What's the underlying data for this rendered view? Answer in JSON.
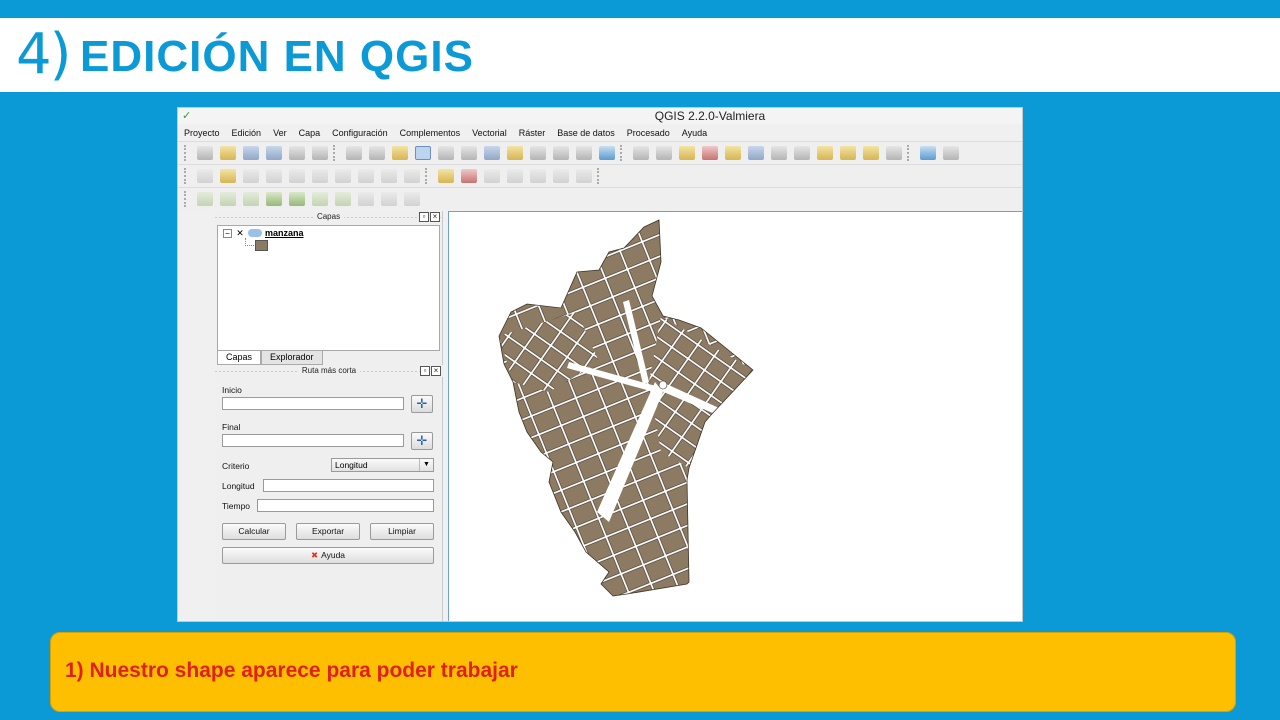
{
  "slide": {
    "title_number": "4)",
    "title_text": "EDICIÓN EN QGIS",
    "caption": "1) Nuestro shape aparece para poder trabajar",
    "colors": {
      "background": "#0b9ad6",
      "caption_bg": "#fdbf00",
      "caption_text": "#e0201a",
      "title": "#0b9ad6"
    }
  },
  "qgis": {
    "window_title": "QGIS 2.2.0-Valmiera",
    "menu": [
      "Proyecto",
      "Edición",
      "Ver",
      "Capa",
      "Configuración",
      "Complementos",
      "Vectorial",
      "Ráster",
      "Base de datos",
      "Procesado",
      "Ayuda"
    ],
    "layers_panel": {
      "title": "Capas",
      "layer_name": "manzana",
      "tabs": [
        "Capas",
        "Explorador"
      ]
    },
    "route_panel": {
      "title": "Ruta más corta",
      "start_label": "Inicio",
      "end_label": "Final",
      "criteria_label": "Criterio",
      "criteria_value": "Longitud",
      "length_label": "Longitud",
      "time_label": "Tiempo",
      "calc_button": "Calcular",
      "export_button": "Exportar",
      "clear_button": "Limpiar",
      "help_button": "Ayuda"
    },
    "map_fill_color": "#8c7a62"
  }
}
